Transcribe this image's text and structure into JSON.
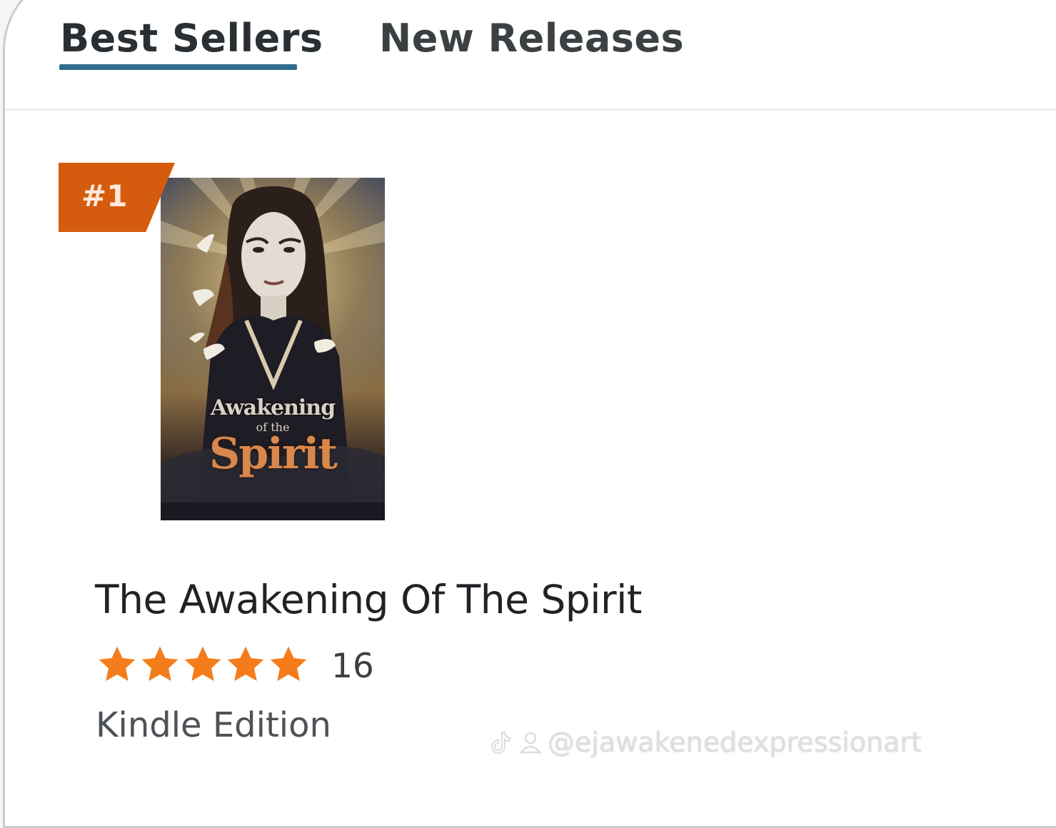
{
  "tabs": [
    {
      "label": "Best Sellers",
      "active": true
    },
    {
      "label": "New Releases",
      "active": false
    }
  ],
  "colors": {
    "tab_underline": "#2f6d8e",
    "rank_badge": "#d55c0e",
    "star": "#f47c1a",
    "text": "#1f2326"
  },
  "product": {
    "rank": "#1",
    "cover": {
      "line1": "Awakening",
      "line2": "of the",
      "line3": "Spirit"
    },
    "title": "The Awakening Of The Spirit",
    "rating": 5,
    "rating_max": 5,
    "rating_count": "16",
    "format": "Kindle Edition"
  },
  "watermark": {
    "icons": [
      "tiktok-icon",
      "user-icon"
    ],
    "handle": "@ejawakenedexpressionart"
  }
}
